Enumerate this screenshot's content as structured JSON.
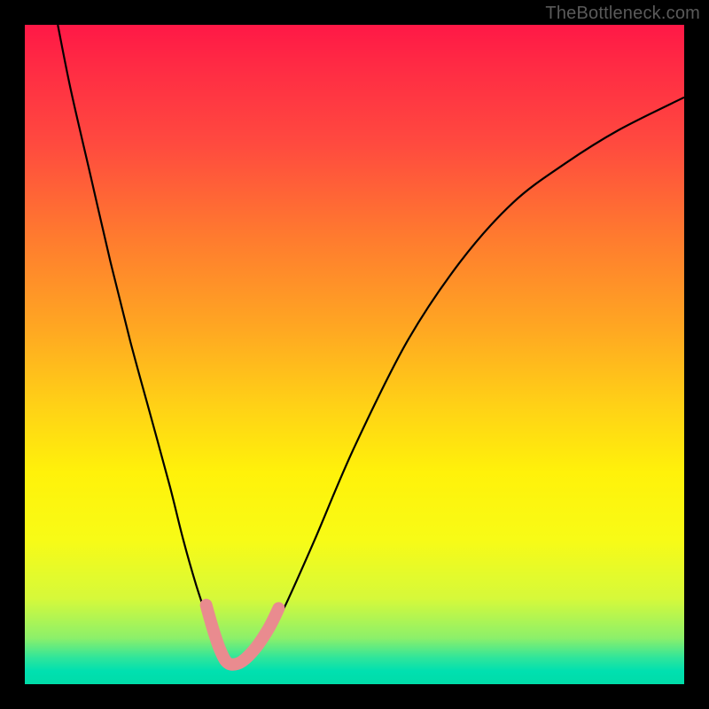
{
  "watermark": {
    "text": "TheBottleneck.com"
  },
  "chart_data": {
    "type": "line",
    "title": "",
    "xlabel": "",
    "ylabel": "",
    "xlim": [
      0,
      100
    ],
    "ylim": [
      0,
      100
    ],
    "grid": false,
    "legend": false,
    "series": [
      {
        "name": "curve",
        "color": "#000000",
        "x": [
          5,
          7,
          10,
          13,
          16,
          19,
          22,
          24,
          26,
          28,
          29.5,
          30.5,
          31.5,
          33,
          36,
          38,
          40,
          44,
          50,
          58,
          66,
          74,
          82,
          90,
          100
        ],
        "y": [
          100,
          90,
          77,
          64,
          52,
          41,
          30,
          22,
          15,
          9,
          5,
          3,
          2.5,
          3,
          6,
          9,
          13,
          22,
          36,
          52,
          64,
          73,
          79,
          84,
          89
        ]
      },
      {
        "name": "marker-band",
        "color": "#e98b8f",
        "style": "thick",
        "x": [
          27.5,
          28.5,
          29.5,
          30.5,
          31.5,
          33,
          35,
          37,
          38.5
        ],
        "y": [
          12,
          8.5,
          5.5,
          3.5,
          3,
          3.5,
          5.5,
          8.5,
          11.5
        ]
      }
    ],
    "background_gradient": {
      "direction": "vertical",
      "stops": [
        {
          "pos": 0,
          "color": "#ff1846"
        },
        {
          "pos": 32,
          "color": "#ff7a2f"
        },
        {
          "pos": 58,
          "color": "#ffd216"
        },
        {
          "pos": 78,
          "color": "#f8fb16"
        },
        {
          "pos": 93,
          "color": "#8cf06a"
        },
        {
          "pos": 100,
          "color": "#00dca8"
        }
      ]
    }
  }
}
